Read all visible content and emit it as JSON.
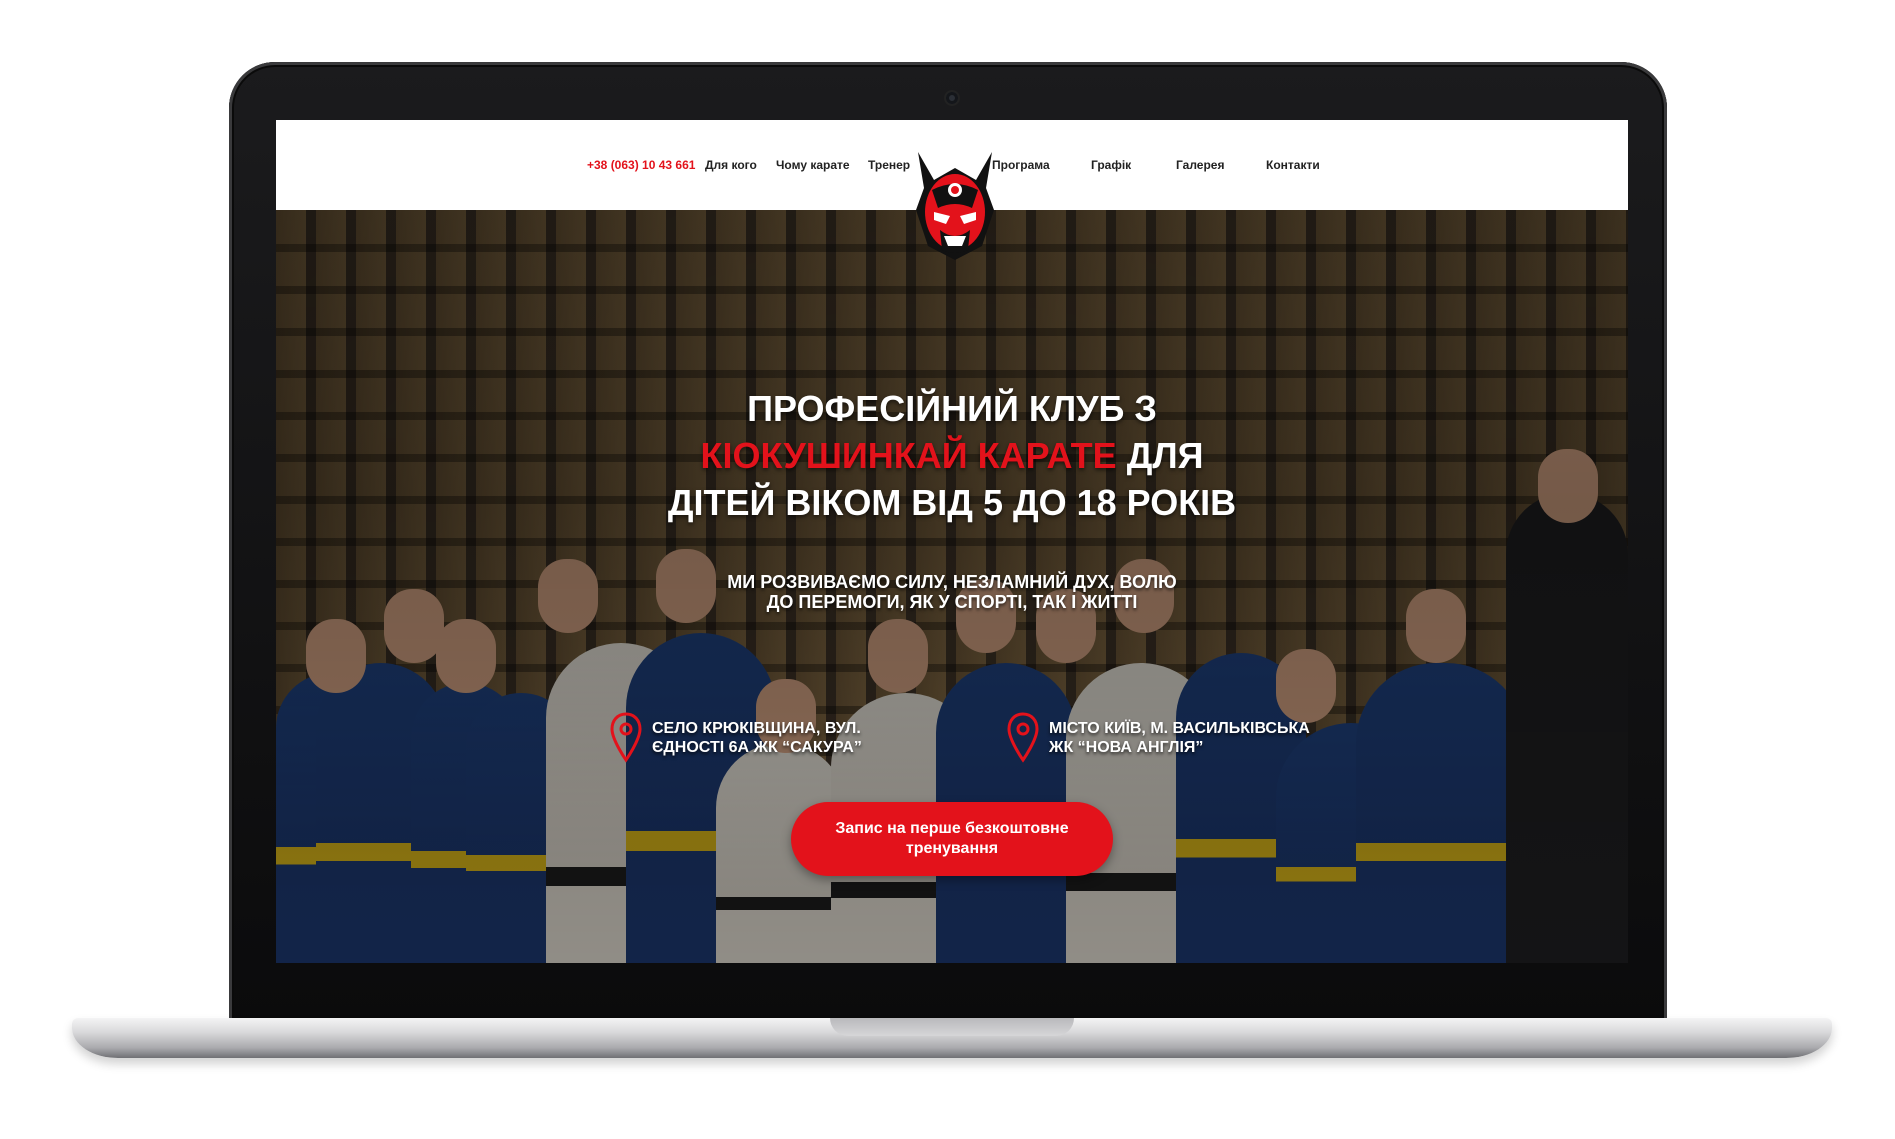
{
  "nav": {
    "phone": "+38 (063) 10 43 661",
    "items": [
      "Для кого",
      "Чому карате",
      "Тренер",
      "Програма",
      "Графік",
      "Галерея",
      "Контакти"
    ]
  },
  "hero": {
    "title_line1": "ПРОФЕСІЙНИЙ КЛУБ З",
    "title_line2_red": "КІОКУШИНКАЙ КАРАТЕ",
    "title_line2_rest": " ДЛЯ",
    "title_line3": "ДІТЕЙ ВІКОМ ВІД 5 ДО 18 РОКІВ",
    "subtitle_line1": "МИ РОЗВИВАЄМО СИЛУ, НЕЗЛАМНИЙ ДУХ, ВОЛЮ",
    "subtitle_line2": "ДО ПЕРЕМОГИ, ЯК У СПОРТІ, ТАК І ЖИТТІ"
  },
  "locations": [
    {
      "line1": "СЕЛО КРЮКІВЩИНА, ВУЛ.",
      "line2": "ЄДНОСТІ 6А ЖК “САКУРА”",
      "icon": "map-pin-icon"
    },
    {
      "line1": "МІСТО КИЇВ, М. ВАСИЛЬКІВСЬКА",
      "line2": "ЖК “НОВА АНГЛІЯ”",
      "icon": "map-pin-icon"
    }
  ],
  "cta": {
    "label": "Запис на перше безкоштовне тренування"
  },
  "colors": {
    "accent": "#e3121b",
    "text_on_dark": "#ffffff",
    "nav_text": "#222222"
  }
}
